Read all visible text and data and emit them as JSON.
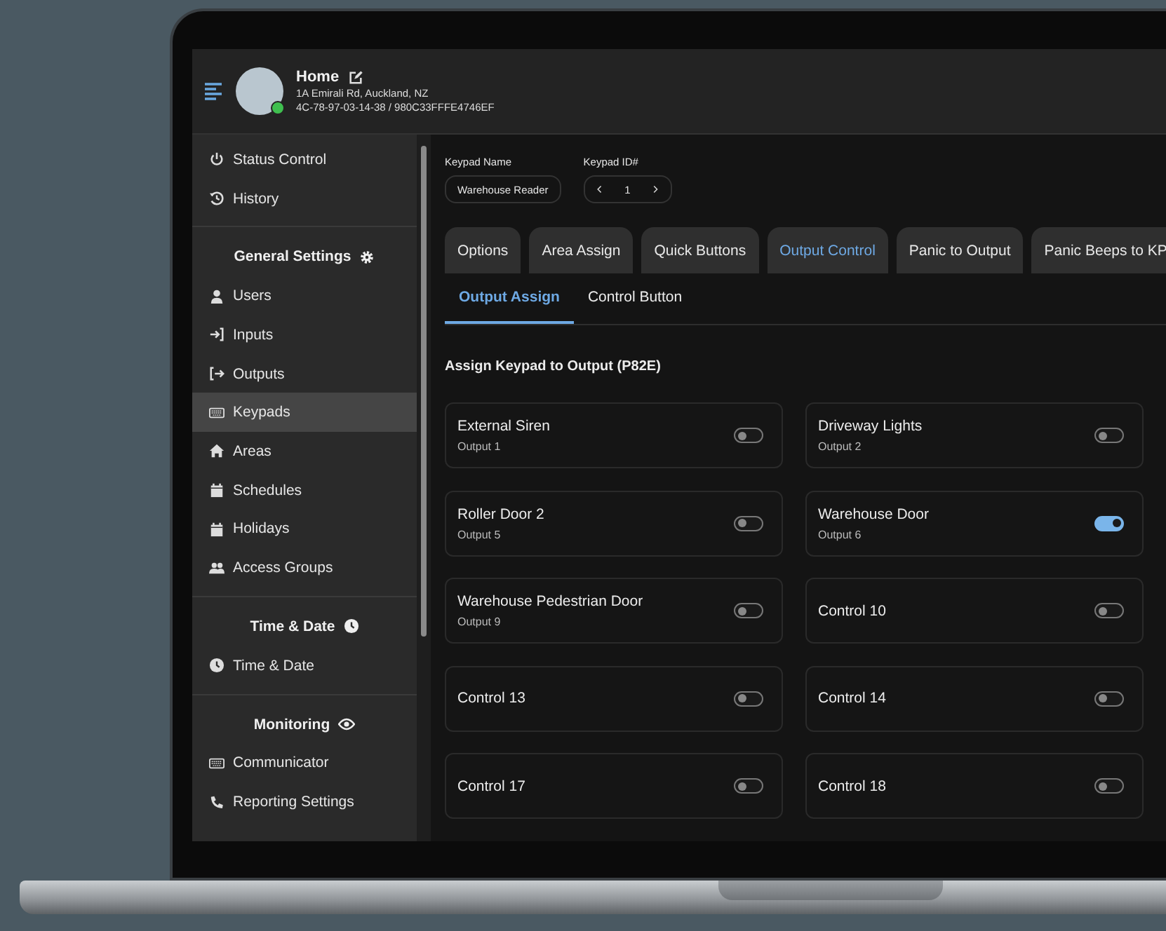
{
  "header": {
    "title": "Home",
    "address": "1A Emirali Rd, Auckland, NZ",
    "device_ids": "4C-78-97-03-14-38 / 980C33FFFE4746EF",
    "online": true
  },
  "sidebar": {
    "sections": [
      {
        "items": [
          {
            "label": "Status Control",
            "selected": false
          },
          {
            "label": "History",
            "selected": false
          }
        ]
      },
      {
        "heading": "General Settings",
        "items": [
          {
            "label": "Users",
            "selected": false
          },
          {
            "label": "Inputs",
            "selected": false
          },
          {
            "label": "Outputs",
            "selected": false
          },
          {
            "label": "Keypads",
            "selected": true
          },
          {
            "label": "Areas",
            "selected": false
          },
          {
            "label": "Schedules",
            "selected": false
          },
          {
            "label": "Holidays",
            "selected": false
          },
          {
            "label": "Access Groups",
            "selected": false
          }
        ]
      },
      {
        "heading": "Time & Date",
        "items": [
          {
            "label": "Time & Date",
            "selected": false
          }
        ]
      },
      {
        "heading": "Monitoring",
        "items": [
          {
            "label": "Communicator",
            "selected": false
          },
          {
            "label": "Reporting Settings",
            "selected": false
          }
        ]
      }
    ]
  },
  "keypad_name": {
    "label": "Keypad Name",
    "value": "Warehouse Reader"
  },
  "keypad_id": {
    "label": "Keypad ID#",
    "value": "1"
  },
  "tabs": [
    {
      "label": "Options",
      "selected": false
    },
    {
      "label": "Area Assign",
      "selected": false
    },
    {
      "label": "Quick Buttons",
      "selected": false
    },
    {
      "label": "Output Control",
      "selected": true
    },
    {
      "label": "Panic to Output",
      "selected": false
    },
    {
      "label": "Panic Beeps to KP",
      "selected": false
    }
  ],
  "subtabs": [
    {
      "label": "Output Assign",
      "selected": true
    },
    {
      "label": "Control Button",
      "selected": false
    }
  ],
  "section_title": "Assign Keypad to Output (P82E)",
  "outputs": [
    {
      "name": "External Siren",
      "subtitle": "Output 1",
      "on": false
    },
    {
      "name": "Driveway Lights",
      "subtitle": "Output 2",
      "on": false
    },
    {
      "name": "Roller Door 2",
      "subtitle": "Output 5",
      "on": false
    },
    {
      "name": "Warehouse Door",
      "subtitle": "Output 6",
      "on": true
    },
    {
      "name": "Warehouse Pedestrian Door",
      "subtitle": "Output 9",
      "on": false
    },
    {
      "name": "Control 10",
      "on": false
    },
    {
      "name": "Control 13",
      "on": false
    },
    {
      "name": "Control 14",
      "on": false
    },
    {
      "name": "Control 17",
      "on": false
    },
    {
      "name": "Control 18",
      "on": false
    }
  ]
}
